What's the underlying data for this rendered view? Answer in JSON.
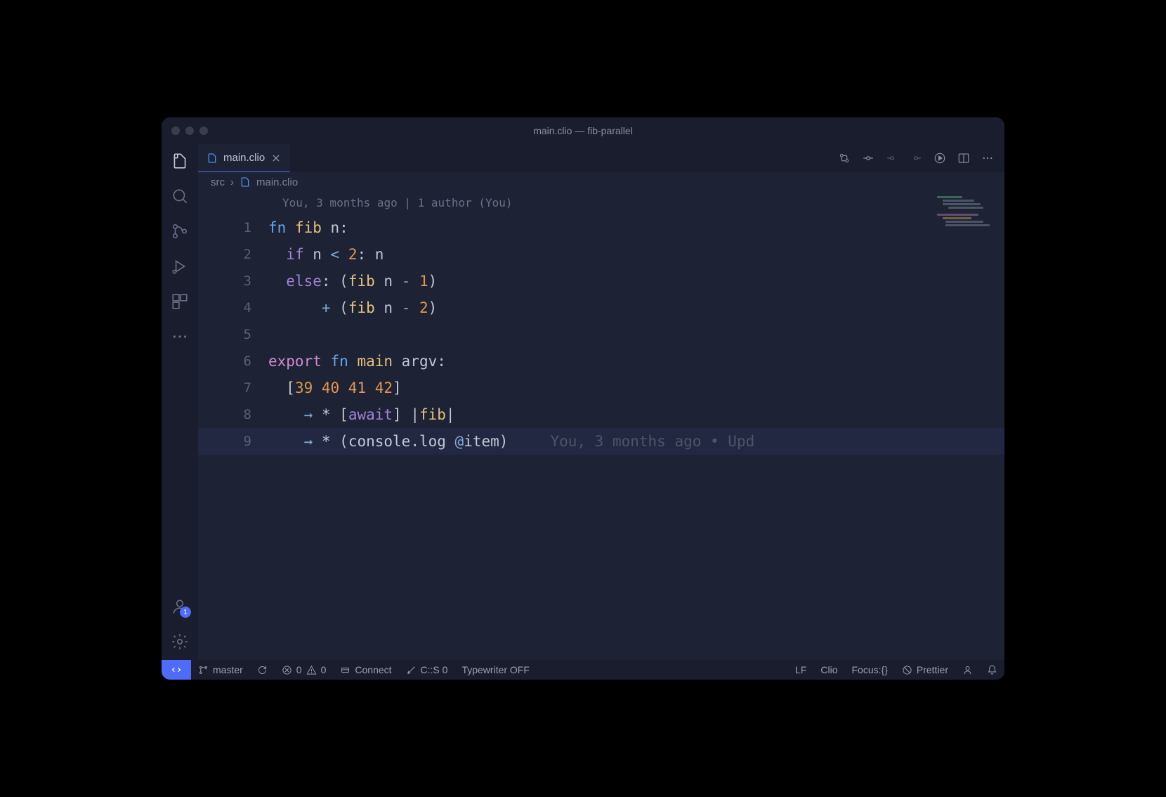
{
  "window": {
    "title": "main.clio — fib-parallel"
  },
  "tab": {
    "label": "main.clio"
  },
  "breadcrumb": {
    "folder": "src",
    "file": "main.clio"
  },
  "codelens": "You, 3 months ago | 1 author (You)",
  "code_lines": [
    {
      "n": "1",
      "tokens": [
        [
          "kw",
          "fn"
        ],
        [
          "",
          ""
        ],
        [
          "fn",
          " fib"
        ],
        [
          "",
          ""
        ],
        [
          "ident",
          " n"
        ],
        [
          "punct",
          ":"
        ]
      ]
    },
    {
      "n": "2",
      "tokens": [
        [
          "",
          "  "
        ],
        [
          "kw2",
          "if"
        ],
        [
          "ident",
          " n "
        ],
        [
          "op",
          "<"
        ],
        [
          "",
          ""
        ],
        [
          "num",
          " 2"
        ],
        [
          "punct",
          ":"
        ],
        [
          "ident",
          " n"
        ]
      ]
    },
    {
      "n": "3",
      "tokens": [
        [
          "",
          "  "
        ],
        [
          "kw2",
          "else"
        ],
        [
          "punct",
          ": ("
        ],
        [
          "fn",
          "fib"
        ],
        [
          "ident",
          " n "
        ],
        [
          "op",
          "-"
        ],
        [
          "",
          ""
        ],
        [
          "num",
          " 1"
        ],
        [
          "punct",
          ")"
        ]
      ]
    },
    {
      "n": "4",
      "tokens": [
        [
          "",
          "      "
        ],
        [
          "op",
          "+"
        ],
        [
          "punct",
          " ("
        ],
        [
          "fn",
          "fib"
        ],
        [
          "ident",
          " n "
        ],
        [
          "op",
          "-"
        ],
        [
          "",
          ""
        ],
        [
          "num",
          " 2"
        ],
        [
          "punct",
          ")"
        ]
      ]
    },
    {
      "n": "5",
      "tokens": [
        [
          "",
          ""
        ]
      ]
    },
    {
      "n": "6",
      "tokens": [
        [
          "kw3",
          "export"
        ],
        [
          "",
          ""
        ],
        [
          "kw",
          " fn"
        ],
        [
          "",
          ""
        ],
        [
          "fn",
          " main"
        ],
        [
          "",
          ""
        ],
        [
          "ident",
          " argv"
        ],
        [
          "punct",
          ":"
        ]
      ]
    },
    {
      "n": "7",
      "tokens": [
        [
          "",
          "  "
        ],
        [
          "punct",
          "["
        ],
        [
          "num",
          "39 40 41 42"
        ],
        [
          "punct",
          "]"
        ]
      ]
    },
    {
      "n": "8",
      "tokens": [
        [
          "",
          "    "
        ],
        [
          "op",
          "→"
        ],
        [
          "ident",
          " * "
        ],
        [
          "punct",
          "["
        ],
        [
          "kw2",
          "await"
        ],
        [
          "punct",
          "] |"
        ],
        [
          "fn",
          "fib"
        ],
        [
          "punct",
          "|"
        ]
      ]
    },
    {
      "n": "9",
      "highlight": true,
      "tokens": [
        [
          "",
          "    "
        ],
        [
          "op",
          "→"
        ],
        [
          "ident",
          " * "
        ],
        [
          "punct",
          "("
        ],
        [
          "ident",
          "console.log "
        ],
        [
          "op",
          "@"
        ],
        [
          "ident",
          "item"
        ],
        [
          "punct",
          ")"
        ]
      ],
      "blame": "You, 3 months ago • Upd"
    }
  ],
  "status": {
    "branch": "master",
    "errors": "0",
    "warnings": "0",
    "connect": "Connect",
    "csso": "C::S 0",
    "typewriter": "Typewriter OFF",
    "eol": "LF",
    "language": "Clio",
    "focus": "Focus:{}",
    "prettier": "Prettier"
  },
  "accounts_badge": "1"
}
